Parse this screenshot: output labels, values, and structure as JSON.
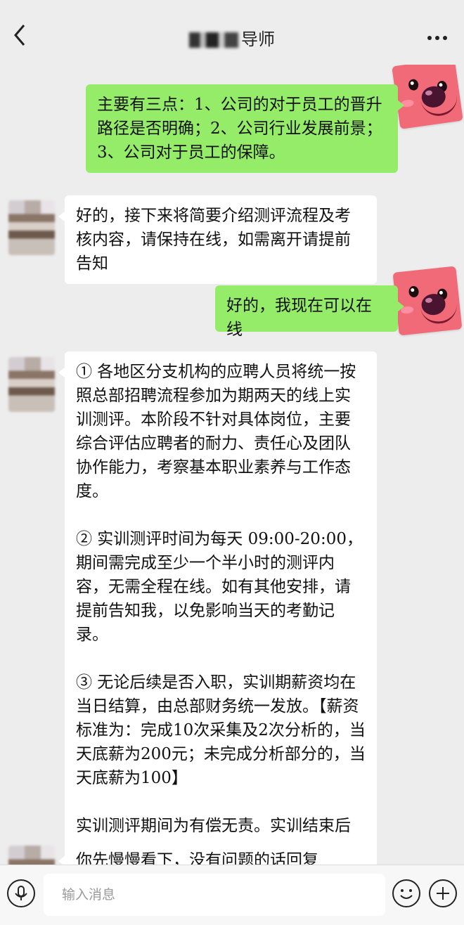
{
  "header": {
    "title": "导师",
    "back_icon": "chevron-left-icon",
    "more_icon": "more-dots-icon"
  },
  "messages": [
    {
      "side": "right",
      "paragraphs": [
        "主要有三点：1、公司的对于员工的晋升路径是否明确；2、公司行业发展前景；3、公司对于员工的保障。"
      ]
    },
    {
      "side": "left",
      "paragraphs": [
        "好的，接下来将简要介绍测评流程及考核内容，请保持在线，如需离开请提前告知"
      ]
    },
    {
      "side": "right",
      "paragraphs": [
        "好的，我现在可以在线"
      ]
    },
    {
      "side": "left",
      "paragraphs": [
        "① 各地区分支机构的应聘人员将统一按照总部招聘流程参加为期两天的线上实训测评。本阶段不针对具体岗位，主要综合评估应聘者的耐力、责任心及团队协作能力，考察基本职业素养与工作态度。",
        "② 实训测评时间为每天 09:00-20:00，期间需完成至少一个半小时的测评内容，无需全程在线。如有其他安排，请提前告知我，以免影响当天的考勤记录。",
        "③ 无论后续是否入职，实训期薪资均在当日结算，由总部财务统一发放。【薪资标准为：完成10次采集及2次分析的，当天底薪为200元；未完成分析部分的，当天底薪为100】",
        "实训测评期间为有偿无责。实训结束后将安排面试，确定正式入职时间，并办理入职手续及签订劳动合同。"
      ]
    },
    {
      "side": "left",
      "paragraphs": [
        "你先慢慢看下，没有问题的话回复"
      ]
    }
  ],
  "input_bar": {
    "placeholder": "输入消息",
    "voice_icon": "microphone-icon",
    "emoji_icon": "emoji-icon",
    "plus_icon": "plus-icon"
  },
  "colors": {
    "background": "#ededed",
    "sent_bubble": "#95ec69",
    "received_bubble": "#ffffff"
  }
}
